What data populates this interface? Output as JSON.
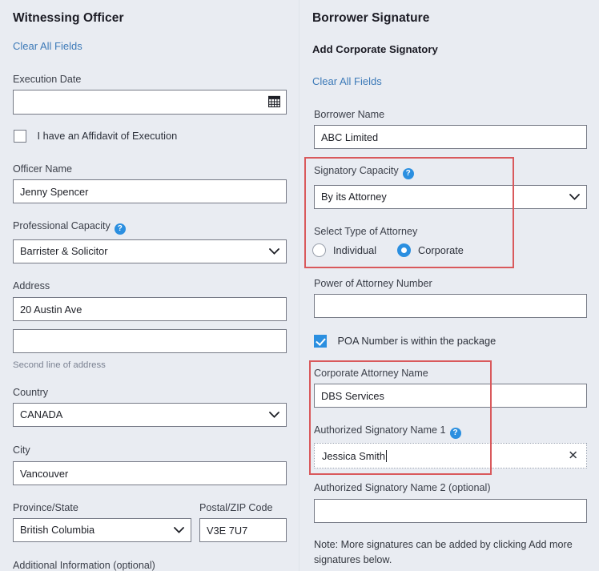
{
  "left": {
    "title": "Witnessing Officer",
    "clear_all": "Clear All Fields",
    "execution_date": {
      "label": "Execution Date",
      "value": "",
      "placeholder": "",
      "icon": "calendar-icon"
    },
    "affidavit_checkbox": {
      "label": "I have an Affidavit of Execution",
      "checked": false
    },
    "officer_name": {
      "label": "Officer Name",
      "value": "Jenny Spencer"
    },
    "professional_capacity": {
      "label": "Professional Capacity",
      "help_icon": "help-icon",
      "value": "Barrister & Solicitor"
    },
    "address": {
      "label": "Address",
      "line1": "20 Austin Ave",
      "line2": "",
      "line2_hint": "Second line of address"
    },
    "country": {
      "label": "Country",
      "value": "CANADA"
    },
    "city": {
      "label": "City",
      "value": "Vancouver"
    },
    "province": {
      "label": "Province/State",
      "value": "British Columbia"
    },
    "postal": {
      "label": "Postal/ZIP Code",
      "value": "V3E 7U7"
    },
    "additional_info": {
      "label": "Additional Information (optional)"
    }
  },
  "right": {
    "title": "Borrower Signature",
    "subtitle": "Add Corporate Signatory",
    "clear_all": "Clear All Fields",
    "borrower_name": {
      "label": "Borrower Name",
      "value": "ABC Limited"
    },
    "signatory_capacity": {
      "label": "Signatory Capacity",
      "help_icon": "help-icon",
      "value": "By its Attorney"
    },
    "attorney_type": {
      "label": "Select Type of Attorney",
      "options": [
        {
          "label": "Individual",
          "selected": false
        },
        {
          "label": "Corporate",
          "selected": true
        }
      ]
    },
    "poa_number": {
      "label": "Power of Attorney Number",
      "value": ""
    },
    "poa_checkbox": {
      "label": "POA Number is within the package",
      "checked": true
    },
    "corporate_attorney_name": {
      "label": "Corporate Attorney Name",
      "value": "DBS Services"
    },
    "authorized_signatory_1": {
      "label": "Authorized Signatory Name 1",
      "help_icon": "help-icon",
      "value": "Jessica Smith",
      "clear_icon": "close-icon",
      "focused": true
    },
    "authorized_signatory_2": {
      "label": "Authorized Signatory Name 2 (optional)",
      "value": ""
    },
    "note": "Note: More signatures can be added by clicking Add more signatures below."
  },
  "highlights": [
    {
      "name": "signatory-capacity-highlight"
    },
    {
      "name": "corporate-attorney-highlight"
    }
  ],
  "colors": {
    "background": "#e9ecf2",
    "accent_blue": "#2b8fe0",
    "link_blue": "#3d7ab8",
    "highlight_red": "#d9595c",
    "field_border": "#767a86",
    "text": "#1d1f26"
  }
}
